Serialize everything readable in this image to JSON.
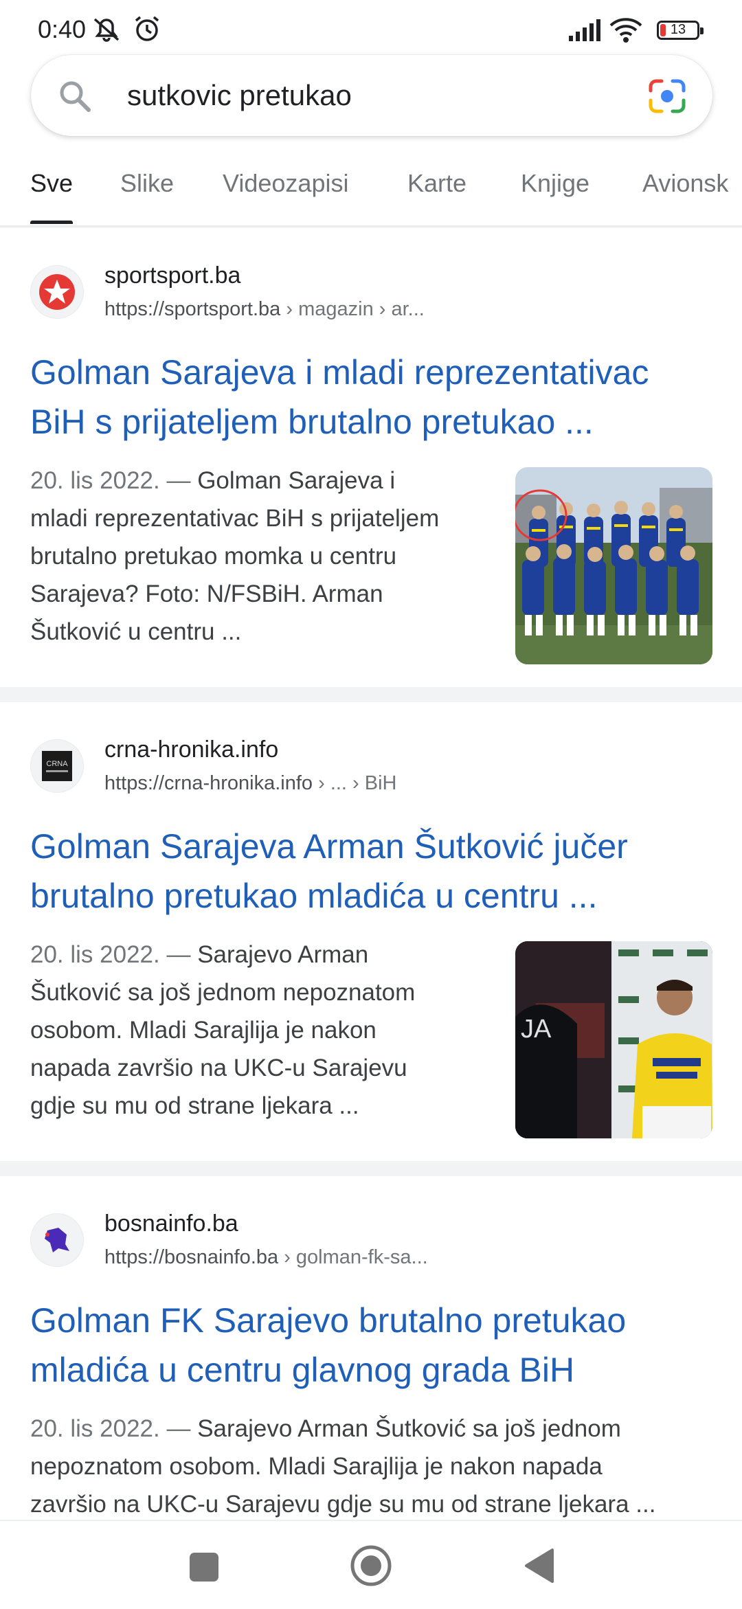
{
  "status_bar": {
    "time": "0:40",
    "battery": "13",
    "battery_color": "#e53935"
  },
  "search": {
    "query": "sutkovic pretukao"
  },
  "tabs": [
    {
      "label": "Sve",
      "active": true
    },
    {
      "label": "Slike"
    },
    {
      "label": "Videozapisi"
    },
    {
      "label": "Karte"
    },
    {
      "label": "Knjige"
    },
    {
      "label": "Avionsk"
    }
  ],
  "results": [
    {
      "site": "sportsport.ba",
      "url": "https://sportsport.ba",
      "crumbs": " › magazin › ar...",
      "title_lines": [
        "Golman Sarajeva i mladi reprezentativac",
        "BiH s prijateljem brutalno pretukao ..."
      ],
      "date": "20. lis 2022. —",
      "snippet_lines": [
        " Golman Sarajeva i",
        "mladi reprezentativac BiH s prijateljem",
        "brutalno pretukao momka u centru",
        "Sarajeva? Foto: N/FSBiH. Arman",
        "Šutković u centru ..."
      ],
      "favicon": "red-star-logo",
      "thumbnail": "football-team-photo"
    },
    {
      "site": "crna-hronika.info",
      "url": "https://crna-hronika.info",
      "crumbs": " › ... › BiH",
      "title_lines": [
        "Golman Sarajeva Arman Šutković jučer",
        "brutalno pretukao mladića u centru ..."
      ],
      "date": "20. lis 2022. —",
      "snippet_lines": [
        " Sarajevo Arman",
        "Šutković sa još jednom nepoznatom",
        "osobom. Mladi Sarajlija je nakon",
        "napada završio na UKC-u Sarajevu",
        "gdje su mu od strane ljekara ..."
      ],
      "favicon": "crna-hronika-logo",
      "favicon_text": "CRNA",
      "thumbnail": "player-and-police-photo"
    },
    {
      "site": "bosnainfo.ba",
      "url": "https://bosnainfo.ba",
      "crumbs": " › golman-fk-sa...",
      "title_lines": [
        "Golman FK Sarajevo brutalno pretukao",
        "mladića u centru glavnog grada BiH"
      ],
      "date": "20. lis 2022. —",
      "snippet_lines": [
        " Sarajevo Arman Šutković sa još jednom",
        "nepoznatom osobom. Mladi Sarajlija je nakon napada",
        "završio na UKC-u Sarajevu gdje su mu od strane ljekara ..."
      ],
      "favicon": "bosnainfo-logo"
    }
  ],
  "colors": {
    "link": "#1f5fb8",
    "accent_red": "#e53935"
  }
}
